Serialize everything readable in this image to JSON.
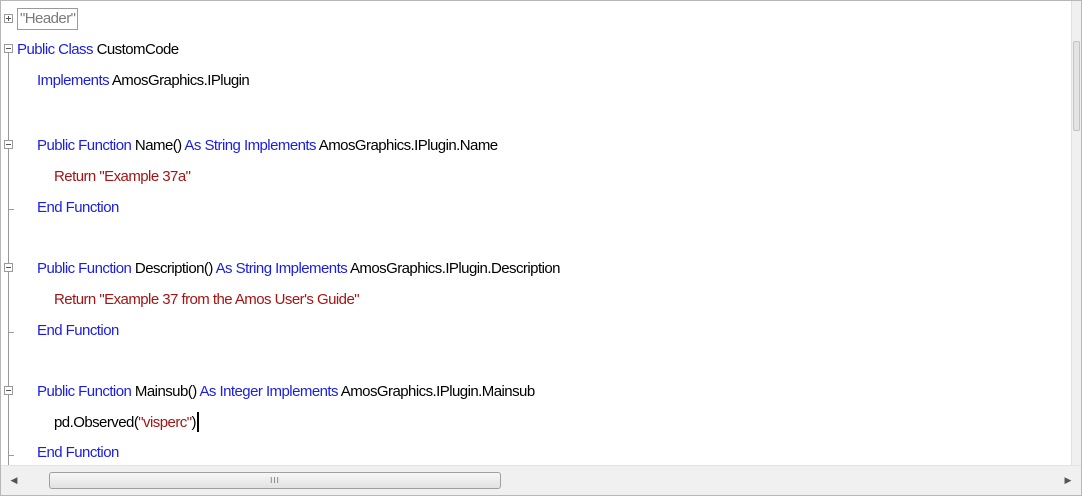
{
  "outline_region": {
    "label": "\"Header\""
  },
  "code": {
    "l2": {
      "kw1": "Public Class ",
      "id1": "CustomCode"
    },
    "l3": {
      "kw1": "Implements ",
      "id1": "AmosGraphics.IPlugin"
    },
    "l5": {
      "kw1": "Public Function ",
      "id1": "Name() ",
      "kw2": "As String Implements ",
      "id2": "AmosGraphics.IPlugin.Name"
    },
    "l6": {
      "id1": "Return ",
      "str1": "\"Example 37a\""
    },
    "l7": {
      "kw1": "End Function"
    },
    "l9": {
      "kw1": "Public Function ",
      "id1": "Description() ",
      "kw2": "As String Implements ",
      "id2": "AmosGraphics.IPlugin.Description"
    },
    "l10": {
      "id1": "Return ",
      "str1": "\"Example 37 from the Amos User's Guide\""
    },
    "l11": {
      "kw1": "End Function"
    },
    "l13": {
      "kw1": "Public Function ",
      "id1": "Mainsub() ",
      "kw2": "As Integer Implements ",
      "id2": "AmosGraphics.IPlugin.Mainsub"
    },
    "l14": {
      "id1": "pd.Observed(",
      "str1": "\"visperc\"",
      "id2": ")"
    },
    "l15": {
      "kw1": "End Function"
    }
  },
  "scrollbar": {
    "left_arrow": "◀",
    "right_arrow": "▶",
    "grip": "III"
  },
  "colors": {
    "keyword": "#1b1ee0",
    "identifier": "#000000",
    "string": "#a31515",
    "outline": "#9a9a9a"
  }
}
